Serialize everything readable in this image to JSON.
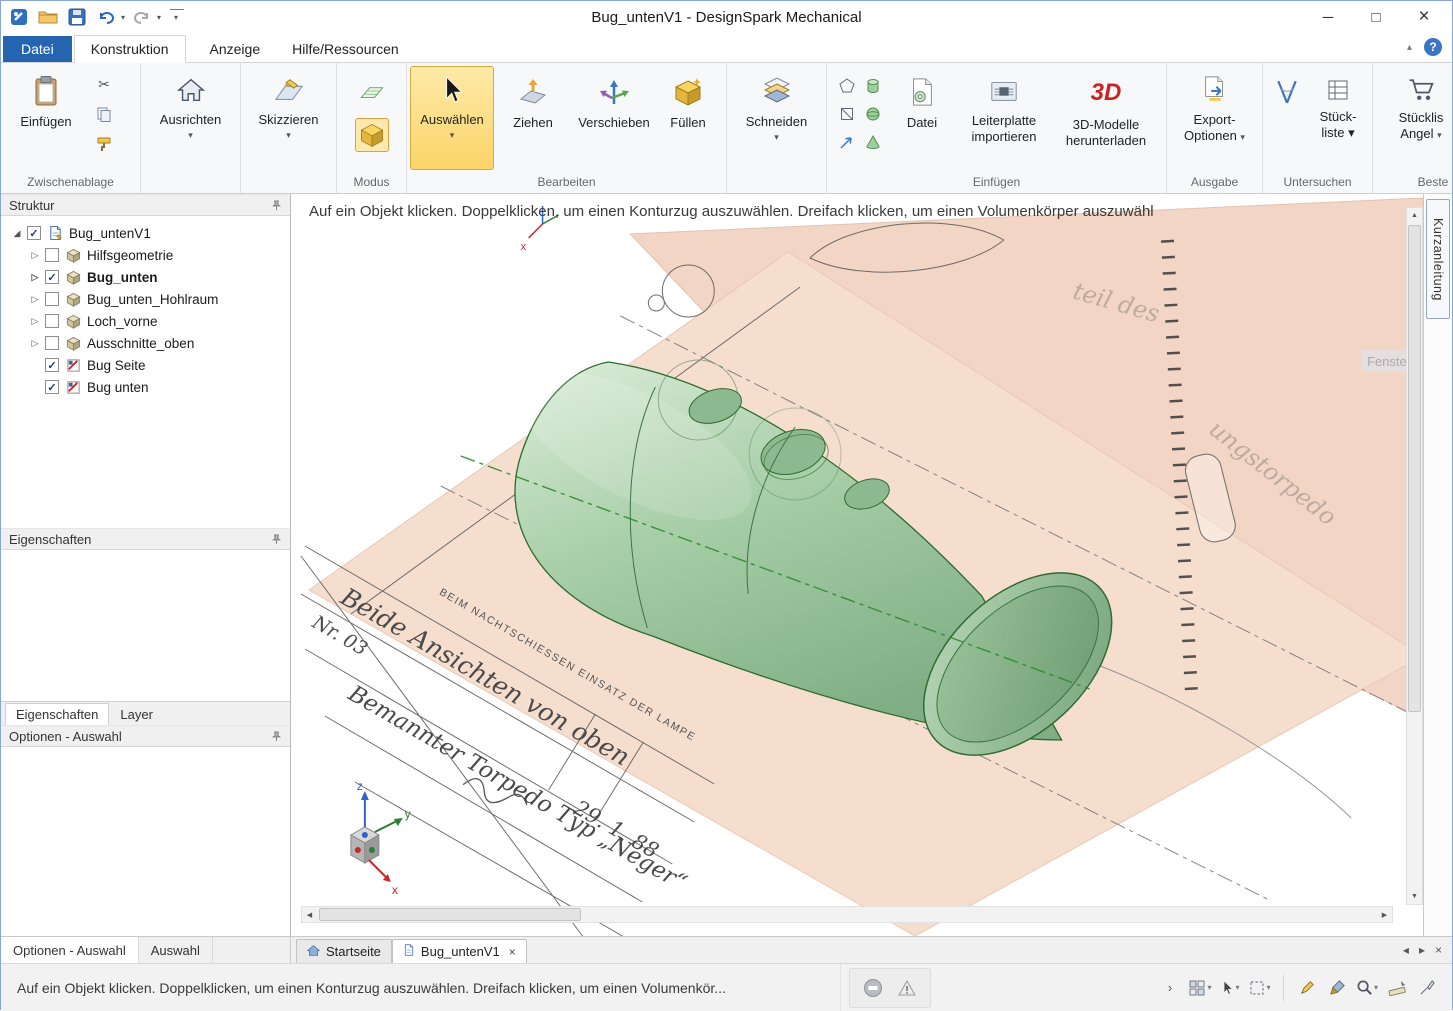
{
  "titlebar": {
    "title": "Bug_untenV1 - DesignSpark Mechanical"
  },
  "icons": {
    "minimize": "─",
    "maximize": "□",
    "close": "×",
    "help": "?",
    "collapse_ribbon": "▴",
    "caret": "▾",
    "cut_glyph": "✂",
    "scroll_up": "▲",
    "scroll_down": "▼",
    "scroll_left": "◀",
    "scroll_right": "▶",
    "tab_prev": "◂",
    "tab_next": "▸",
    "tab_close": "×",
    "chevron_right": "›"
  },
  "menu_tabs": {
    "datei": "Datei",
    "konstruktion": "Konstruktion",
    "anzeige": "Anzeige",
    "hilfe": "Hilfe/Ressourcen"
  },
  "ribbon": {
    "paste": "Einfügen",
    "group_clipboard": "Zwischenablage",
    "align": "Ausrichten",
    "sketch_mode": "Skizzieren",
    "group_mode": "Modus",
    "select": "Auswählen",
    "pull": "Ziehen",
    "move": "Verschieben",
    "fill": "Füllen",
    "group_edit": "Bearbeiten",
    "section": "Schneiden",
    "file": "Datei",
    "pcb_line1": "Leiterplatte",
    "pcb_line2": "importieren",
    "models_line1": "3D-Modelle",
    "models_line2": "herunterladen",
    "threed": "3D",
    "group_insert": "Einfügen",
    "export_line1": "Export-",
    "export_line2": "Optionen",
    "group_output": "Ausgabe",
    "bom_line1": "Stück-",
    "bom_line2": "liste",
    "group_inspect": "Untersuchen",
    "cutoff_line1": "Stücklis",
    "cutoff_line2": "Angel",
    "group_cutoff": "Beste"
  },
  "structure_panel": {
    "header": "Struktur",
    "items": [
      {
        "label": "Bug_untenV1",
        "check": "✓",
        "expander": "◢"
      },
      {
        "label": "Hilfsgeometrie",
        "check": "",
        "expander": "▷"
      },
      {
        "label": "Bug_unten",
        "check": "✓",
        "expander": "▷"
      },
      {
        "label": "Bug_unten_Hohlraum",
        "check": "",
        "expander": "▷"
      },
      {
        "label": "Loch_vorne",
        "check": "",
        "expander": "▷"
      },
      {
        "label": "Ausschnitte_oben",
        "check": "",
        "expander": "▷"
      },
      {
        "label": "Bug Seite",
        "check": "✓",
        "expander": ""
      },
      {
        "label": "Bug unten",
        "check": "✓",
        "expander": ""
      }
    ]
  },
  "properties_panel": {
    "header": "Eigenschaften"
  },
  "panel_tabs": {
    "eigenschaften": "Eigenschaften",
    "layer": "Layer"
  },
  "options_panel": {
    "header": "Optionen - Auswahl"
  },
  "bottom_panel_tabs": {
    "optionen": "Optionen - Auswahl",
    "auswahl": "Auswahl"
  },
  "viewport": {
    "hint": "Auf ein Objekt klicken. Doppelklicken, um einen Konturzug auszuwählen. Dreifach klicken, um einen Volumenkörper auszuwähl",
    "side_tab": "Kurzanleitung",
    "fenster_hint": "Fenste",
    "triad": {
      "x": "x",
      "y": "y",
      "z": "z"
    },
    "drawing": {
      "number": "Nr. 03",
      "note_caps": "BEIM NACHTSCHIESSEN EINSATZ DER LAMPE",
      "caption_line1": "Beide Ansichten von oben",
      "caption_line2": "Bemannter Torpedo Typ „Neger“",
      "date": "29. 1. 88",
      "faint_text1": "teil des",
      "faint_text2": "ungstorpedo"
    }
  },
  "doc_tabs": {
    "startseite": "Startseite",
    "active_doc": "Bug_untenV1"
  },
  "statusbar": {
    "message": "Auf ein Objekt klicken. Doppelklicken, um einen Konturzug auszuwählen. Dreifach klicken, um einen Volumenkör..."
  },
  "colors": {
    "tab_blue": "#2565b0",
    "selection_yellow": "#fcd468",
    "model_green": "#a8cfa8",
    "paper_salmon": "#f5dccd",
    "logo_red": "#cc2222"
  }
}
